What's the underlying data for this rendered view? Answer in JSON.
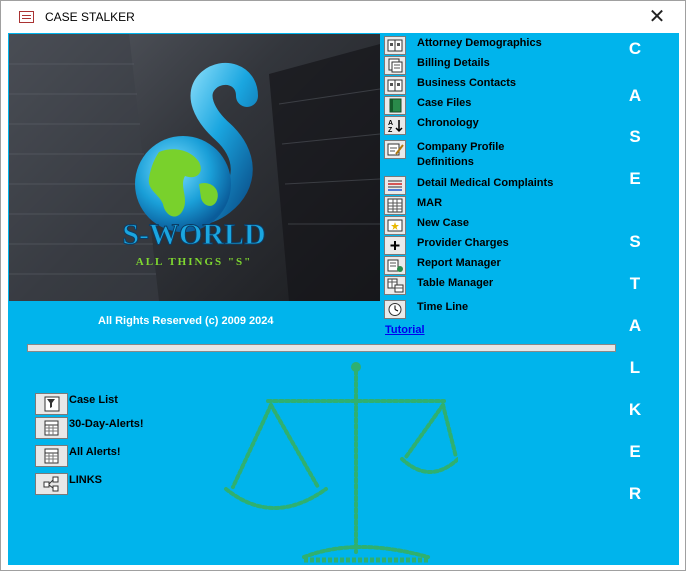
{
  "window": {
    "title": "CASE STALKER",
    "close_glyph": "✕"
  },
  "logo": {
    "brand": "S-WORLD",
    "tagline": "ALL THINGS \"S\""
  },
  "copyright": "All Rights Reserved (c) 2009 2024",
  "menu": [
    {
      "label": "Attorney Demographics",
      "icon": "address-book-icon"
    },
    {
      "label": "Billing Details",
      "icon": "documents-icon"
    },
    {
      "label": "Business Contacts",
      "icon": "address-book-icon"
    },
    {
      "label": "Case Files",
      "icon": "binder-icon"
    },
    {
      "label": "Chronology",
      "icon": "sort-az-icon"
    },
    {
      "label": "Company Profile",
      "label2": "Definitions",
      "icon": "edit-form-icon"
    },
    {
      "label": "Detail  Medical Complaints",
      "icon": "report-icon"
    },
    {
      "label": "MAR",
      "icon": "grid-icon"
    },
    {
      "label": "New Case",
      "icon": "new-record-icon"
    },
    {
      "label": "Provider Charges",
      "icon": "plus-icon"
    },
    {
      "label": "Report Manager",
      "icon": "report-manager-icon"
    },
    {
      "label": "Table Manager",
      "icon": "table-icon"
    },
    {
      "label": "Time Line",
      "icon": "clock-icon"
    }
  ],
  "tutorial": "Tutorial",
  "side_title": [
    "C",
    "A",
    "S",
    "E",
    "S",
    "T",
    "A",
    "L",
    "K",
    "E",
    "R"
  ],
  "progress": {
    "value": 0
  },
  "quick_links": [
    {
      "label": "Case List",
      "icon": "filter-list-icon"
    },
    {
      "label": "30-Day-Alerts!",
      "icon": "calendar-icon"
    },
    {
      "label": "All Alerts!",
      "icon": "calendar-icon"
    },
    {
      "label": "LINKS",
      "icon": "network-icon"
    }
  ],
  "colors": {
    "form_background": "#00b4ec",
    "scales": "#2fb070",
    "logo_green": "#7fd830"
  }
}
